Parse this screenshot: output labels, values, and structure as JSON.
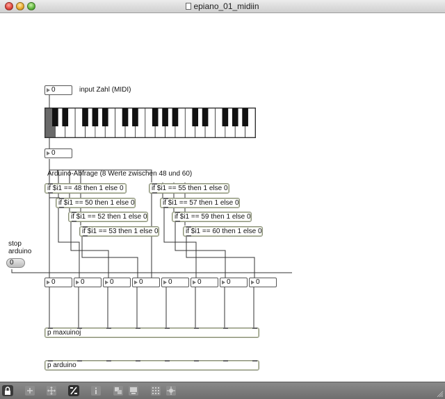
{
  "window": {
    "title": "epiano_01_midiin"
  },
  "patch": {
    "input_number": "0",
    "input_label": "input Zahl (MIDI)",
    "keyboard_number": "0",
    "arduino_comment": "Arduino-Abfrage (8 Werte zwischen 48 und 60)",
    "conditions": [
      "if $i1 == 48 then 1 else 0",
      "if $i1 == 50 then 1 else 0",
      "if $i1 == 52 then 1 else 0",
      "if $i1 == 53 then 1 else 0",
      "if $i1 == 55 then 1 else 0",
      "if $i1 == 57 then 1 else 0",
      "if $i1 == 59 then 1 else 0",
      "if $i1 == 60 then 1 else 0"
    ],
    "stop_label": "stop\narduino",
    "stop_value": "0",
    "outputs": [
      "0",
      "0",
      "0",
      "0",
      "0",
      "0",
      "0",
      "0"
    ],
    "maxuino_object": "p maxuinoj",
    "arduino_object": "p arduino"
  },
  "toolbar": {
    "icons": [
      "lock-icon",
      "add-icon",
      "move-icon",
      "patch-cord-icon",
      "info-icon",
      "new-view-icon",
      "presentation-icon",
      "grid-icon",
      "snap-icon"
    ]
  },
  "colors": {
    "object_border": "#8a8f7a",
    "toolbar_bg": "#7c7c7c"
  }
}
